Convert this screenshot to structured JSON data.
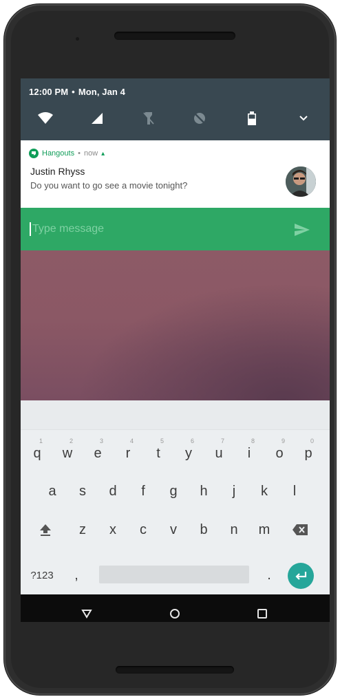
{
  "status": {
    "time": "12:00 PM",
    "separator": "•",
    "date": "Mon, Jan 4"
  },
  "quick_settings": {
    "icons": [
      "wifi-icon",
      "cellular-signal-icon",
      "flashlight-off-icon",
      "auto-rotate-off-icon",
      "battery-icon",
      "expand-chevron-icon"
    ]
  },
  "notification": {
    "app_name": "Hangouts",
    "dot": "•",
    "time": "now",
    "expand_glyph": "▴",
    "sender": "Justin Rhyss",
    "message": "Do you want to go see a movie tonight?"
  },
  "reply": {
    "placeholder": "Type message",
    "send_icon": "send-icon"
  },
  "keyboard": {
    "row1": [
      {
        "key": "q",
        "hint": "1"
      },
      {
        "key": "w",
        "hint": "2"
      },
      {
        "key": "e",
        "hint": "3"
      },
      {
        "key": "r",
        "hint": "4"
      },
      {
        "key": "t",
        "hint": "5"
      },
      {
        "key": "y",
        "hint": "6"
      },
      {
        "key": "u",
        "hint": "7"
      },
      {
        "key": "i",
        "hint": "8"
      },
      {
        "key": "o",
        "hint": "9"
      },
      {
        "key": "p",
        "hint": "0"
      }
    ],
    "row2": [
      "a",
      "s",
      "d",
      "f",
      "g",
      "h",
      "j",
      "k",
      "l"
    ],
    "row3": [
      "z",
      "x",
      "c",
      "v",
      "b",
      "n",
      "m"
    ],
    "symbols_label": "?123",
    "comma": ",",
    "period": "."
  },
  "colors": {
    "quick_settings_bg": "#394851",
    "hangouts_green": "#0f9d58",
    "reply_bar": "#2ea865",
    "enter_key": "#26a69a",
    "keyboard_bg": "#eceff1"
  },
  "navigation": [
    "back-icon",
    "home-icon",
    "recents-icon"
  ]
}
